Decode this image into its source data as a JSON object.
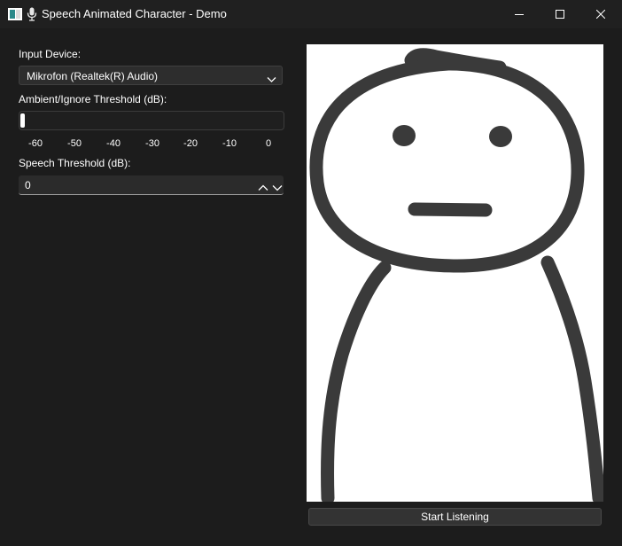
{
  "window": {
    "title": "Speech Animated Character - Demo"
  },
  "controls": {
    "input_device_label": "Input Device:",
    "input_device_value": "Mikrofon (Realtek(R) Audio)",
    "ambient_label": "Ambient/Ignore Threshold (dB):",
    "ambient_level_fraction": 0.0,
    "ambient_ticks": [
      "-60",
      "-50",
      "-40",
      "-30",
      "-20",
      "-10",
      "0"
    ],
    "speech_label": "Speech Threshold (dB):",
    "speech_value": "0"
  },
  "character": {
    "expression": "neutral",
    "line_color": "#3a3a3a",
    "background": "#ffffff"
  },
  "actions": {
    "start_label": "Start Listening"
  },
  "icons": {
    "app": "window-icon",
    "mic": "microphone-icon",
    "minimize": "minimize-icon",
    "maximize": "maximize-icon",
    "close": "close-icon",
    "dropdown": "chevron-down-icon",
    "spin_up": "chevron-up-icon",
    "spin_down": "chevron-down-icon"
  }
}
